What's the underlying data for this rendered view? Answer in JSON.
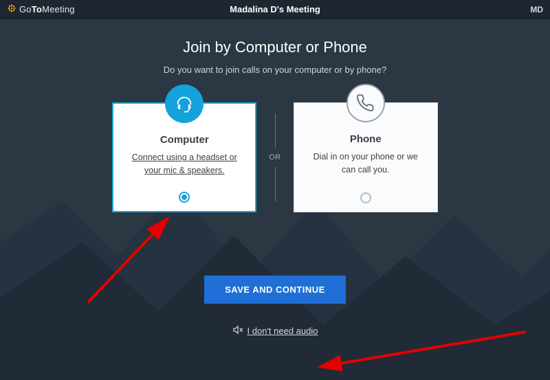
{
  "header": {
    "logo_go": "Go",
    "logo_to": "To",
    "logo_meeting": "Meeting",
    "title": "Madalina D's Meeting",
    "user_initials": "MD"
  },
  "main": {
    "title": "Join by Computer or Phone",
    "subtitle": "Do you want to join calls on your computer or by phone?",
    "or_label": "OR"
  },
  "cards": {
    "computer": {
      "title": "Computer",
      "desc": "Connect using a headset or your mic & speakers.",
      "selected": true
    },
    "phone": {
      "title": "Phone",
      "desc": "Dial in on your phone or we can call you.",
      "selected": false
    }
  },
  "actions": {
    "save_label": "SAVE AND CONTINUE",
    "no_audio_label": "I don't need audio"
  },
  "colors": {
    "accent": "#14a2dc",
    "primary_button": "#1f6fd6",
    "header_bg": "#1e2731",
    "body_bg": "#2b3742"
  }
}
